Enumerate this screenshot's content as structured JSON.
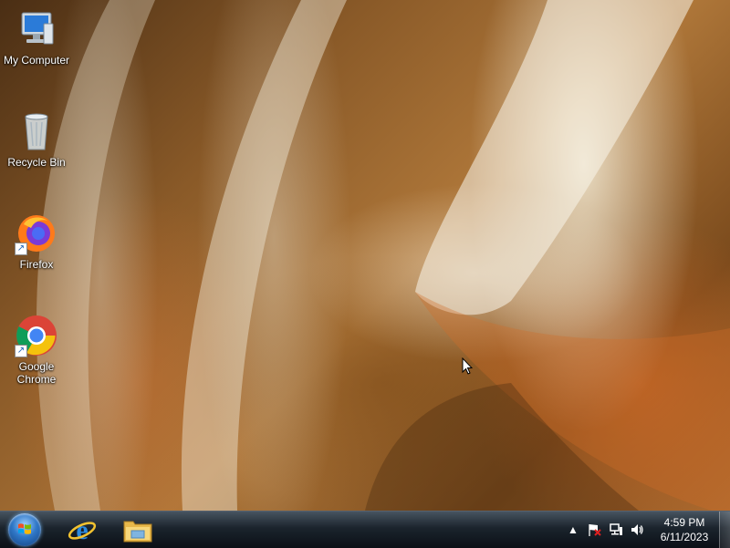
{
  "desktop": {
    "icons": [
      {
        "label": "My Computer",
        "icon": "computer-icon"
      },
      {
        "label": "Recycle Bin",
        "icon": "recycle-bin-icon"
      },
      {
        "label": "Firefox",
        "icon": "firefox-icon"
      },
      {
        "label": "Google Chrome",
        "icon": "chrome-icon"
      }
    ]
  },
  "taskbar": {
    "start": {
      "icon": "windows-start-orb-icon"
    },
    "pinned": [
      {
        "icon": "internet-explorer-icon"
      },
      {
        "icon": "file-explorer-icon"
      }
    ],
    "tray": {
      "icons": [
        "show-hidden-icons-arrow",
        "action-center-flag-icon",
        "network-icon",
        "volume-icon"
      ],
      "time": "4:59 PM",
      "date": "6/11/2023"
    }
  },
  "colors": {
    "taskbar": "#141c26",
    "wallpaper_primary": "#a86a30",
    "icon_label": "#ffffff"
  }
}
